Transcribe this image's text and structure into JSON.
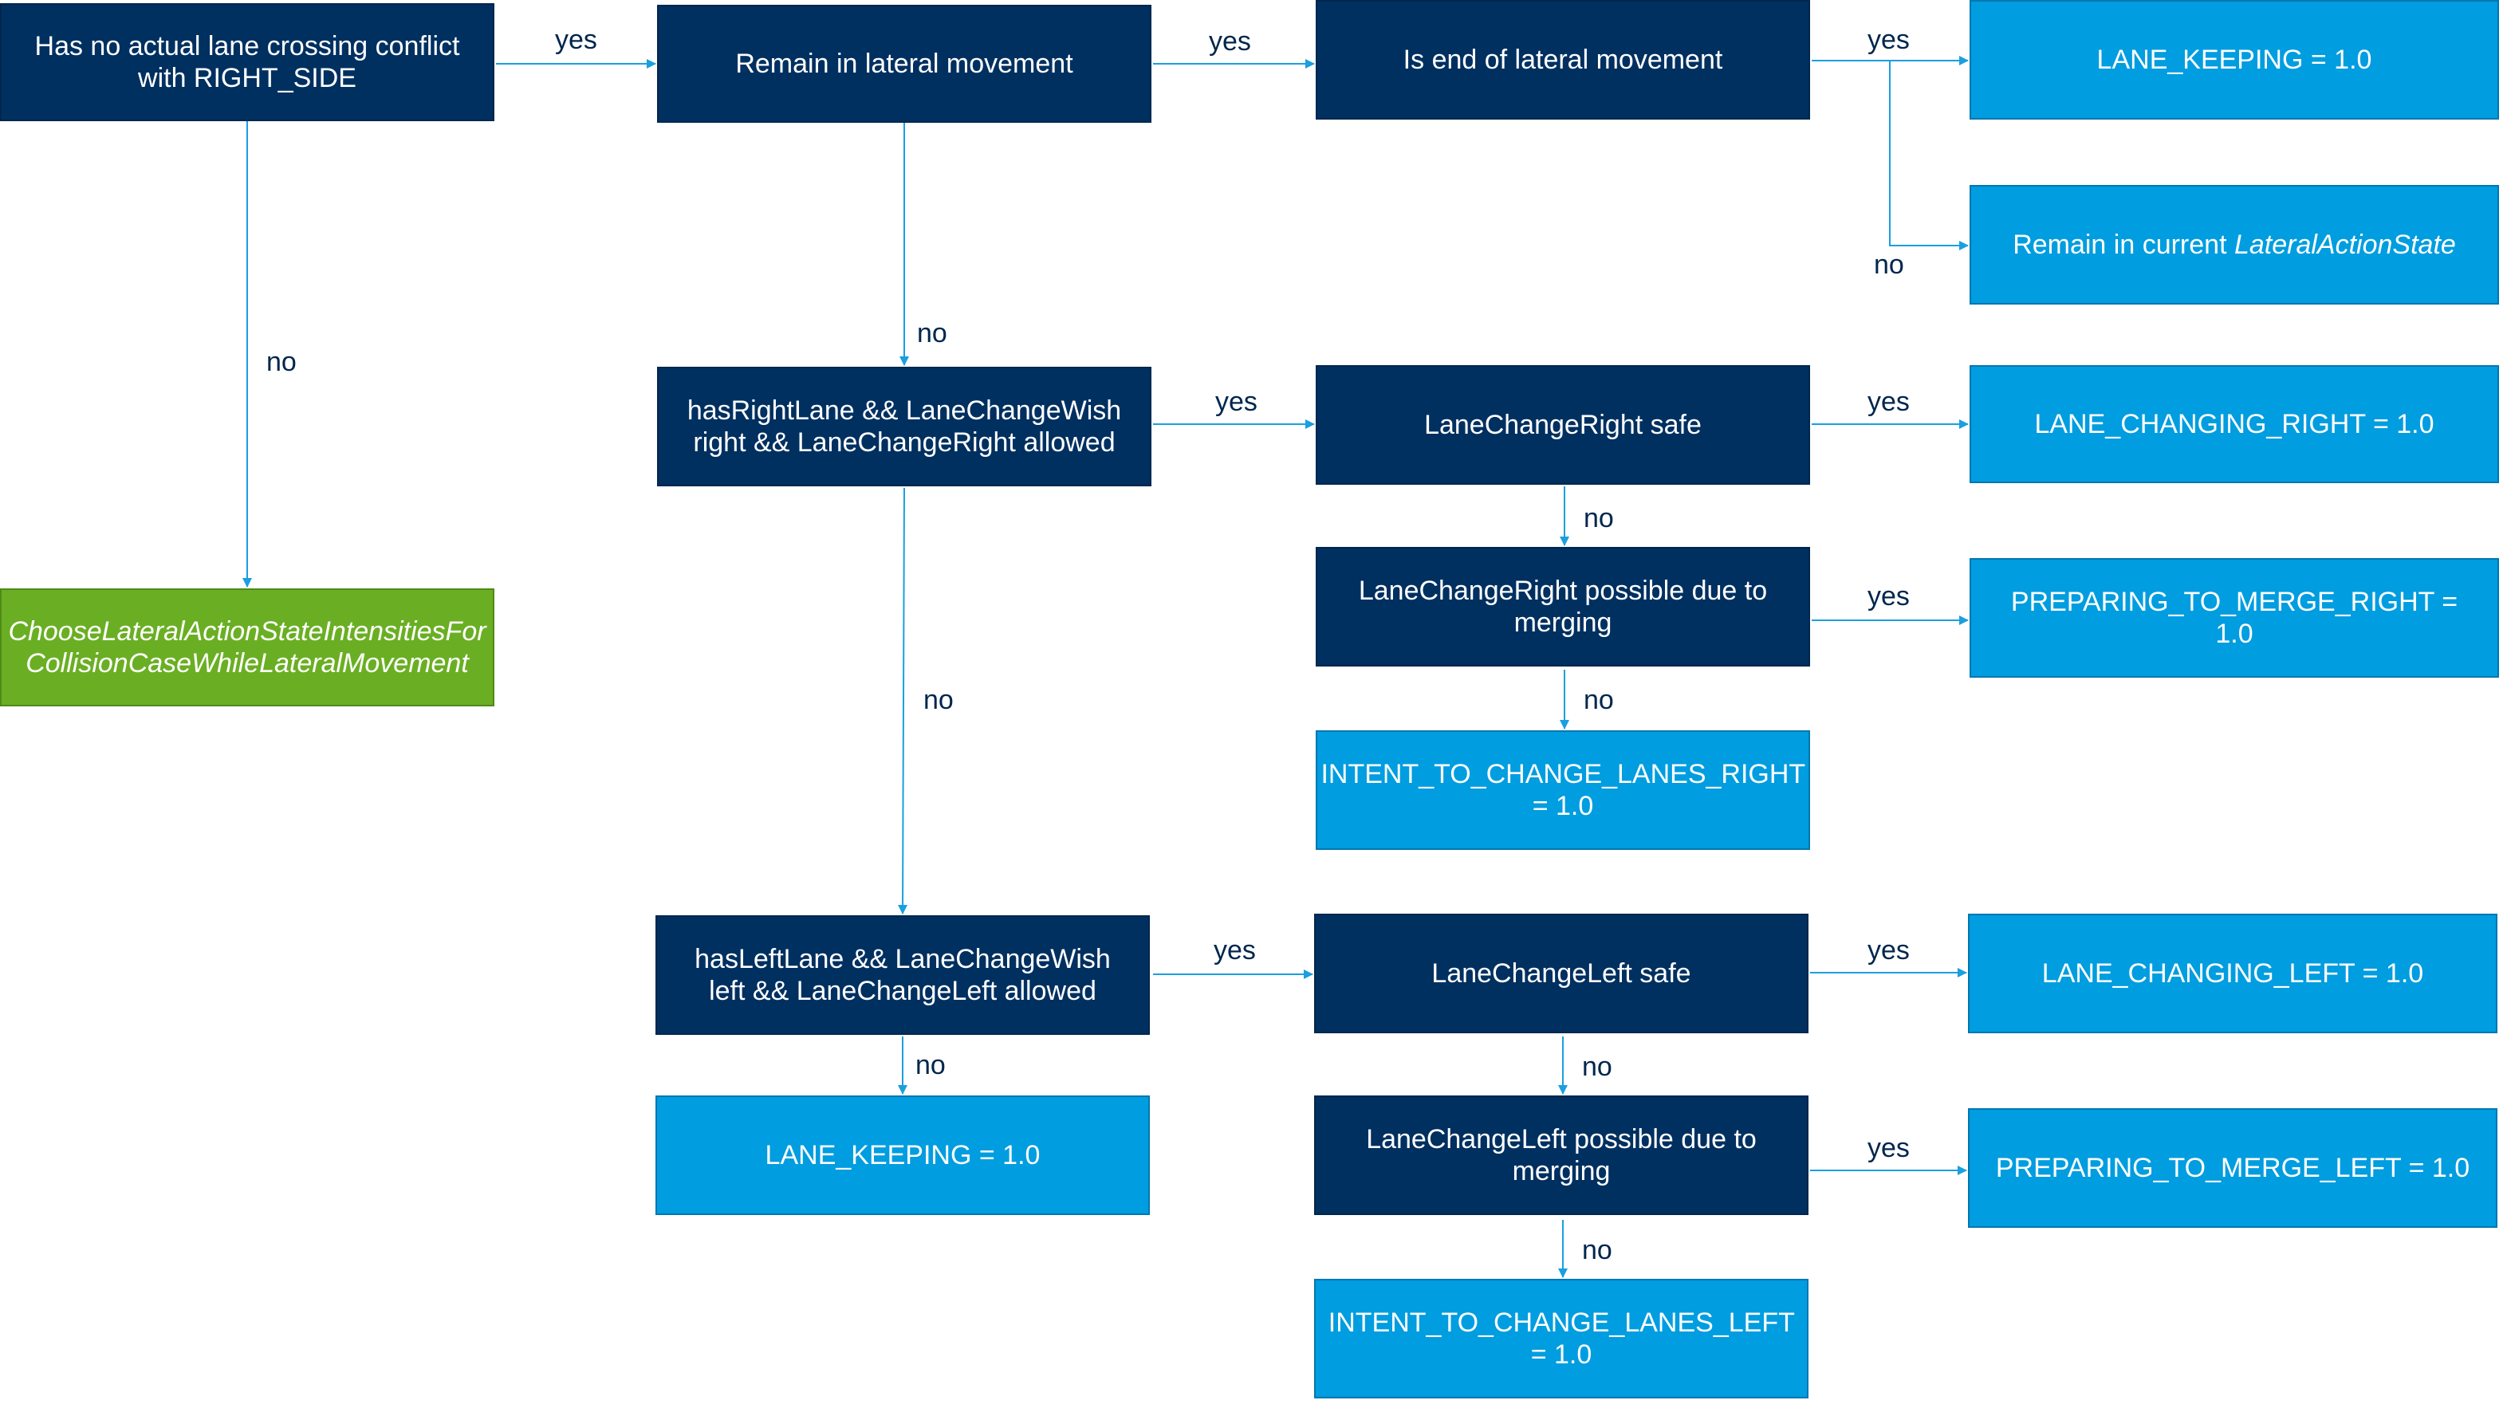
{
  "diagram": {
    "nodes": {
      "root": "Has no actual lane crossing conflict with RIGHT_SIDE",
      "remain_lateral": "Remain in lateral movement",
      "end_lateral": "Is end of lateral movement",
      "lane_keeping_top": "LANE_KEEPING = 1.0",
      "remain_current_prefix": "Remain in current ",
      "remain_current_italic": "LateralActionState",
      "has_right": "hasRightLane && LaneChangeWish right && LaneChangeRight allowed",
      "lcr_safe": "LaneChangeRight safe",
      "lane_changing_right": "LANE_CHANGING_RIGHT = 1.0",
      "lcr_merging": "LaneChangeRight possible due to merging",
      "prep_merge_right": "PREPARING_TO_MERGE_RIGHT = 1.0",
      "intent_right": "INTENT_TO_CHANGE_LANES_RIGHT = 1.0",
      "collision_case": "ChooseLateralActionStateIntensitiesFor CollisionCaseWhileLateralMovement",
      "has_left": "hasLeftLane && LaneChangeWish left && LaneChangeLeft allowed",
      "lcl_safe": "LaneChangeLeft safe",
      "lane_changing_left": "LANE_CHANGING_LEFT = 1.0",
      "lane_keeping_left": "LANE_KEEPING = 1.0",
      "lcl_merging": "LaneChangeLeft possible due to merging",
      "prep_merge_left": "PREPARING_TO_MERGE_LEFT = 1.0",
      "intent_left": "INTENT_TO_CHANGE_LANES_LEFT = 1.0"
    },
    "labels": {
      "yes": "yes",
      "no": "no"
    },
    "colors": {
      "decision": "#003060",
      "result": "#009de0",
      "subroutine": "#6aaf23",
      "edge": "#1a9fe0",
      "label_text": "#00264d"
    }
  }
}
